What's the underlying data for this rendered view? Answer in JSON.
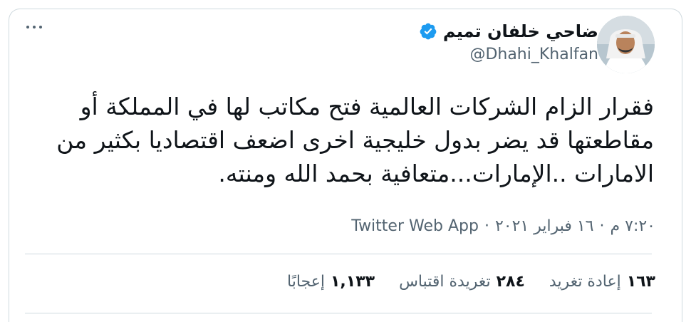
{
  "author": {
    "name": "ضاحي خلفان تميم",
    "handle": "@Dhahi_Khalfan",
    "verified_icon": "verified-badge-icon",
    "accent": "#1d9bf0"
  },
  "menu_icon": "more-dots-icon",
  "tweet": {
    "text": "فقرار الزام الشركات العالمية فتح مكاتب لها في المملكة أو مقاطعتها قد يضر بدول خليجية اخرى اضعف اقتصاديا بكثير من الامارات ..الإمارات...متعافية بحمد الله ومنته.",
    "time": "٧:٢٠ م",
    "date": "١٦ فبراير ٢٠٢١",
    "separator": "·",
    "source": "Twitter Web App"
  },
  "stats": {
    "retweets_count": "١٦٣",
    "retweets_label": "إعادة تغريد",
    "quotes_count": "٢٨٤",
    "quotes_label": "تغريدة اقتباس",
    "likes_count": "١,١٣٣",
    "likes_label": "إعجابًا"
  }
}
